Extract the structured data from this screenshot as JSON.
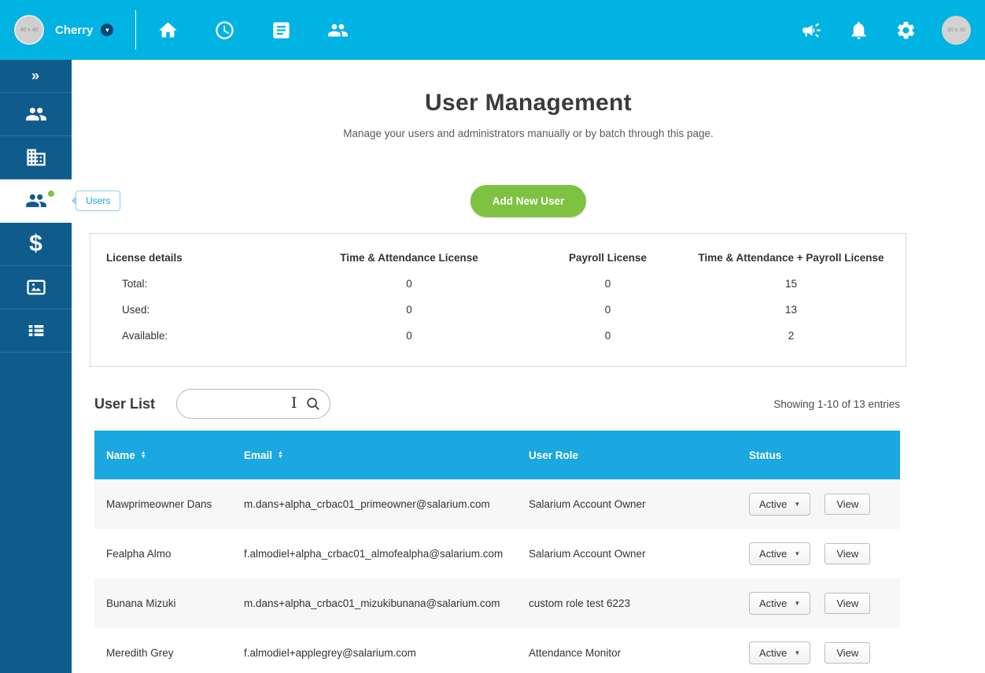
{
  "topbar": {
    "company_name": "Cherry",
    "left_avatar_label": "40 x 40",
    "right_avatar_label": "30 x 30",
    "caret": "▾"
  },
  "sidebar": {
    "expander": "»",
    "tooltip": "Users",
    "dollar": "$"
  },
  "page": {
    "title": "User Management",
    "subtitle": "Manage your users and administrators manually or by batch through this page.",
    "add_user_button": "Add New User"
  },
  "license": {
    "columns": [
      "License details",
      "Time & Attendance License",
      "Payroll License",
      "Time & Attendance + Payroll License"
    ],
    "rows": [
      {
        "label": "Total:",
        "ta": "0",
        "payroll": "0",
        "combo": "15"
      },
      {
        "label": "Used:",
        "ta": "0",
        "payroll": "0",
        "combo": "13"
      },
      {
        "label": "Available:",
        "ta": "0",
        "payroll": "0",
        "combo": "2"
      }
    ]
  },
  "user_list": {
    "heading": "User List",
    "search_placeholder": "",
    "showing": "Showing 1-10 of 13 entries",
    "columns": {
      "name": "Name",
      "email": "Email",
      "role": "User Role",
      "status": "Status"
    },
    "sort_up": "▲",
    "sort_down": "▼",
    "dd_caret": "▼",
    "rows": [
      {
        "name": "Mawprimeowner Dans",
        "email": "m.dans+alpha_crbac01_primeowner@salarium.com",
        "role": "Salarium Account Owner",
        "status": "Active",
        "action": "View"
      },
      {
        "name": "Fealpha Almo",
        "email": "f.almodiel+alpha_crbac01_almofealpha@salarium.com",
        "role": "Salarium Account Owner",
        "status": "Active",
        "action": "View"
      },
      {
        "name": "Bunana Mizuki",
        "email": "m.dans+alpha_crbac01_mizukibunana@salarium.com",
        "role": "custom role test 6223",
        "status": "Active",
        "action": "View"
      },
      {
        "name": "Meredith Grey",
        "email": "f.almodiel+applegrey@salarium.com",
        "role": "Attendance Monitor",
        "status": "Active",
        "action": "View"
      }
    ]
  },
  "colors": {
    "topbar": "#00b3e3",
    "sidebar": "#0f5c8c",
    "accent_green": "#7fc241",
    "table_header_blue": "#1ba7e0"
  }
}
